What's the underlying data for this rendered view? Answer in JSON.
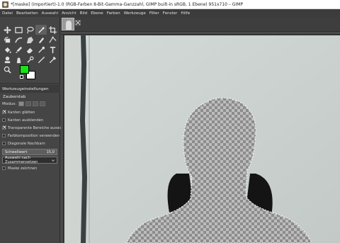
{
  "window": {
    "title": "*[maske] (importiert)-1.0 (RGB-Farben 8-Bit-Gamma-Ganzzahl, GIMP built-in sRGB, 1 Ebene) 951x710 – GIMP"
  },
  "menu": [
    "Datei",
    "Bearbeiten",
    "Auswahl",
    "Ansicht",
    "Bild",
    "Ebene",
    "Farben",
    "Werkzeuge",
    "Filter",
    "Fenster",
    "Hilfe"
  ],
  "colors": {
    "foreground": "#19e219",
    "background": "#ffffff"
  },
  "tools": [
    {
      "name": "move-tool-icon"
    },
    {
      "name": "rect-select-tool-icon"
    },
    {
      "name": "lasso-tool-icon"
    },
    {
      "name": "fuzzy-select-tool-icon",
      "active": true
    },
    {
      "name": "crop-tool-icon"
    },
    {
      "name": "rotate-tool-icon"
    },
    {
      "name": "warp-tool-icon"
    },
    {
      "name": "cage-tool-icon"
    },
    {
      "name": "heal-tool-icon"
    },
    {
      "name": "paths-tool-icon"
    },
    {
      "name": "bucket-fill-tool-icon"
    },
    {
      "name": "paintbrush-tool-icon"
    },
    {
      "name": "eraser-tool-icon"
    },
    {
      "name": "airbrush-tool-icon"
    },
    {
      "name": "text-tool-icon"
    },
    {
      "name": "clone-tool-icon"
    },
    {
      "name": "smudge-tool-icon"
    },
    {
      "name": "dodge-tool-icon"
    },
    {
      "name": "measure-tool-icon"
    },
    {
      "name": "color-picker-tool-icon"
    },
    {
      "name": "zoom-tool-icon"
    }
  ],
  "tool_options": {
    "header": "Werkzeugeinstellungen",
    "title": "Zauberstab",
    "mode_label": "Modus:",
    "options": [
      {
        "label": "Kanten glätten",
        "checked": true
      },
      {
        "label": "Kanten ausblenden",
        "checked": false
      },
      {
        "label": "Transparente Bereiche auswählen",
        "checked": true
      },
      {
        "label": "Farbkomposition verwenden",
        "checked": false
      },
      {
        "label": "Diagonale Nachbarn",
        "checked": false
      }
    ],
    "threshold_label": "Schwellwert",
    "threshold_value": "15,0",
    "select_by": "Auswahl nach Zusammensetzen",
    "draw_mask": "Maske zeichnen"
  }
}
